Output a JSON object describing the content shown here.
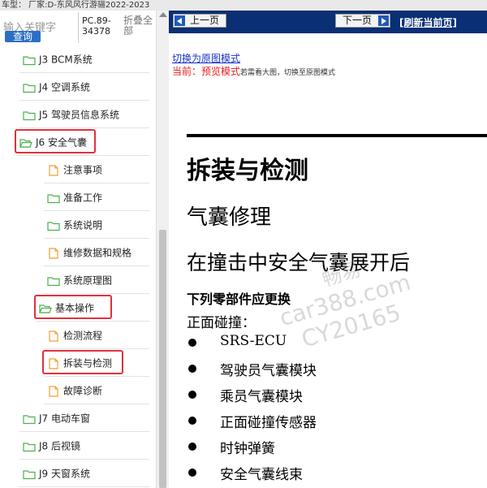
{
  "topbar": {
    "text": "车型：  厂家:D-东风风行游骊2022-2023"
  },
  "search": {
    "placeholder": "输入关键字",
    "query_label": "查询",
    "code_line1": "PC.89-",
    "code_line2": "34378",
    "collapse_line1": "折叠全",
    "collapse_line2": "部"
  },
  "tree": {
    "items": [
      {
        "label": "J3 BCM系统",
        "type": "folder"
      },
      {
        "label": "J4 空调系统",
        "type": "folder"
      },
      {
        "label": "J5 驾驶员信息系统",
        "type": "folder"
      },
      {
        "label": "J6 安全气囊",
        "type": "folder-open",
        "highlighted": true
      },
      {
        "label": "注意事项",
        "type": "page"
      },
      {
        "label": "准备工作",
        "type": "folder"
      },
      {
        "label": "系统说明",
        "type": "folder"
      },
      {
        "label": "维修数据和规格",
        "type": "page"
      },
      {
        "label": "系统原理图",
        "type": "folder"
      },
      {
        "label": "基本操作",
        "type": "folder-open",
        "highlighted": true
      },
      {
        "label": "检测流程",
        "type": "page"
      },
      {
        "label": "拆装与检测",
        "type": "page",
        "highlighted": true
      },
      {
        "label": "故障诊断",
        "type": "page"
      },
      {
        "label": "J7 电动车窗",
        "type": "folder"
      },
      {
        "label": "J8 后视镜",
        "type": "folder"
      },
      {
        "label": "J9 天窗系统",
        "type": "folder"
      }
    ]
  },
  "nav": {
    "prev_label": "上一页",
    "next_label": "下一页",
    "refresh_label": "[刷新当前页]"
  },
  "mode": {
    "switch_link": "切换为原图模式",
    "current_label": "当前：预览模式",
    "current_hint": "若需看大图，切换至原图模式"
  },
  "document": {
    "title": "拆装与检测",
    "subtitle1": "气囊修理",
    "subtitle2": "在撞击中安全气囊展开后",
    "parts_heading": "下列零部件应更换",
    "front_label": "正面碰撞：",
    "bullets": [
      "SRS-ECU",
      "驾驶员气囊模块",
      "乘员气囊模块",
      "正面碰撞传感器",
      "时钟弹簧",
      "安全气囊线束"
    ]
  },
  "watermark": {
    "line1": "畅易",
    "line2": "car388.com",
    "line3": "CY20165"
  },
  "colors": {
    "nav_bar": "#0a2f74",
    "highlight": "#e0313d",
    "link": "#1a33c9",
    "mode_red": "#e81d1d",
    "folder": "#4caf50",
    "page": "#f0a030"
  }
}
